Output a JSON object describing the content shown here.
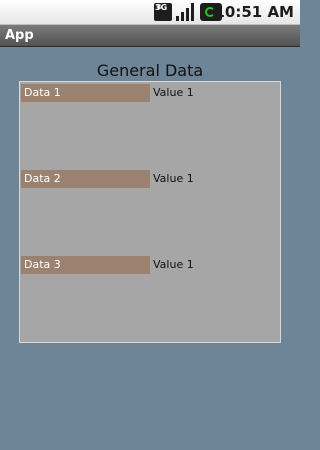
{
  "status_bar": {
    "network_badge": "3G",
    "time": "10:51 AM",
    "icons": [
      "3g-icon",
      "signal-icon",
      "sync-icon"
    ]
  },
  "app_bar": {
    "title": "App"
  },
  "main": {
    "heading": "General Data",
    "rows": [
      {
        "label": "Data 1",
        "value": "Value 1"
      },
      {
        "label": "Data 2",
        "value": "Value 1"
      },
      {
        "label": "Data 3",
        "value": "Value 1"
      }
    ]
  },
  "colors": {
    "background": "#6e8497",
    "panel": "#a6a6a6",
    "label_bg": "#9b8170",
    "title_bar": "#5f5f5f"
  }
}
